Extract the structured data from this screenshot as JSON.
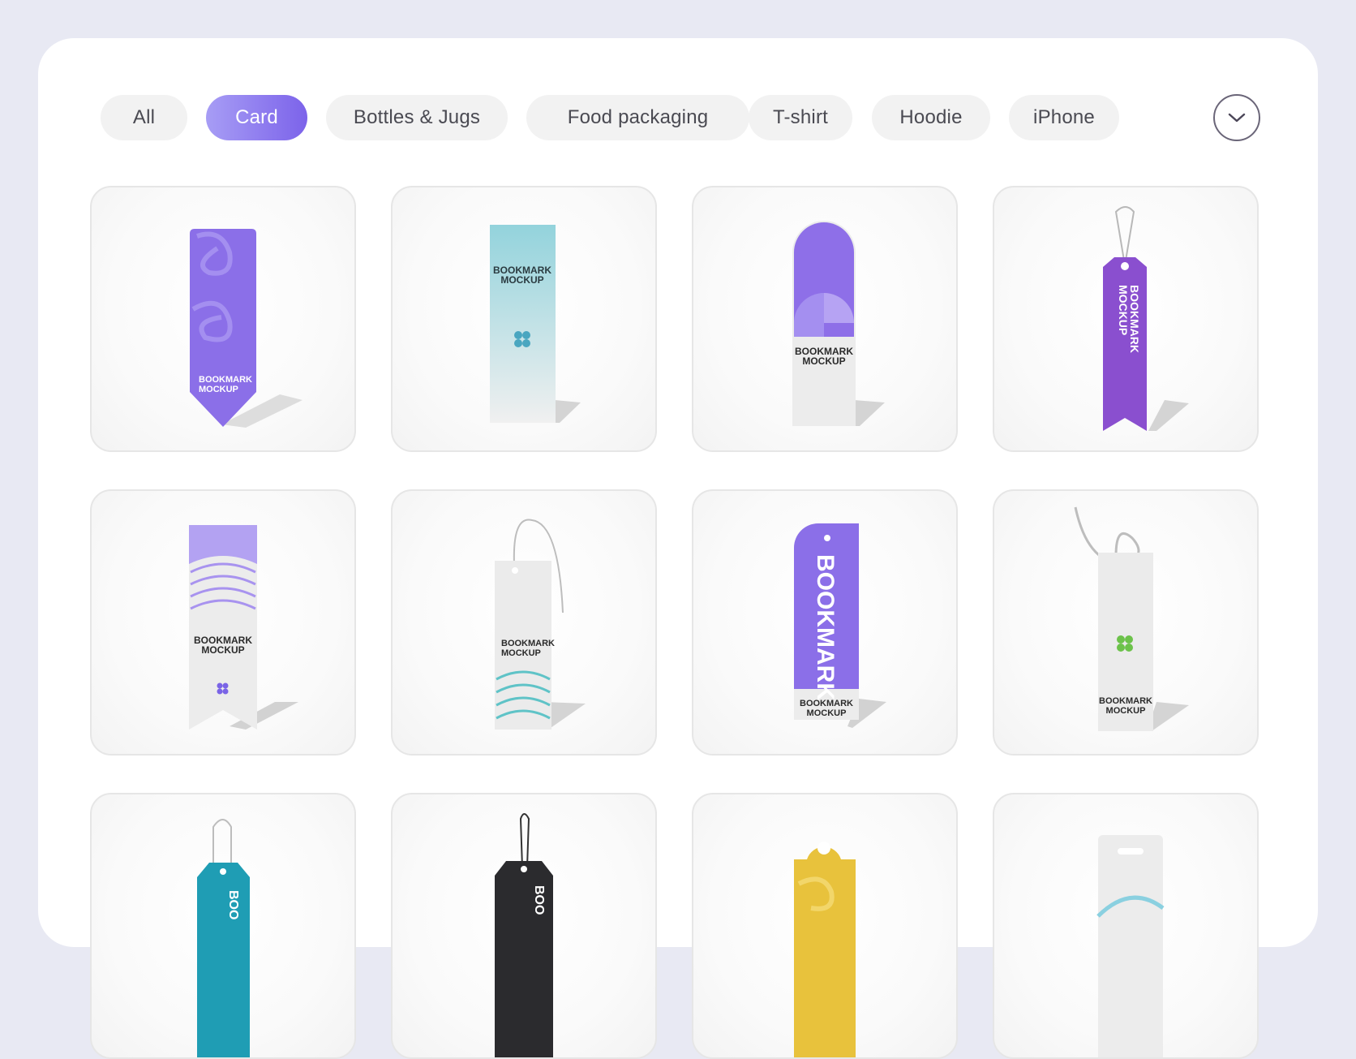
{
  "filters": {
    "chips": [
      "All",
      "Card",
      "Bottles & Jugs",
      "Food packaging",
      "T-shirt",
      "Hoodie",
      "iPhone"
    ],
    "active": "Card"
  },
  "dropdown": {
    "icon": "chevron-down-icon"
  },
  "bookmark": {
    "line1": "BOOKMARK",
    "line2": "MOCKUP",
    "vertical": "BOOKMARK",
    "partial": "BOO"
  },
  "colors": {
    "accent": "#7c63ea",
    "purple": "#8b6fe8",
    "teal": "#1fa3b6",
    "yellow": "#e8c23c",
    "dark": "#2b2b2e"
  }
}
